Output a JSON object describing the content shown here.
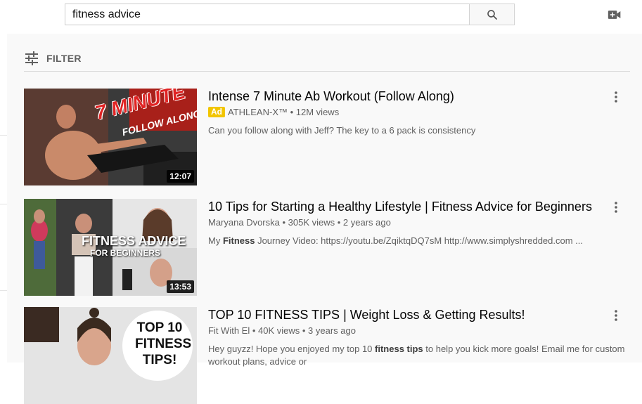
{
  "search": {
    "value": "fitness advice"
  },
  "icons": {
    "search": "search-icon",
    "create": "video-camera-add-icon",
    "filter": "filter-sliders-icon",
    "menu": "more-vert-icon"
  },
  "filter": {
    "label": "FILTER"
  },
  "results": [
    {
      "title": "Intense 7 Minute Ab Workout (Follow Along)",
      "ad_label": "Ad",
      "channel": "ATHLEAN-X™",
      "views": "12M views",
      "age": "",
      "desc_plain": "Can you follow along with Jeff? The key to a 6 pack is consistency",
      "duration": "12:07",
      "thumb_text_main": "7 MINUTE",
      "thumb_text_sub": "FOLLOW ALONG!"
    },
    {
      "title": "10 Tips for Starting a Healthy Lifestyle | Fitness Advice for Beginners",
      "channel": "Maryana Dvorska",
      "views": "305K views",
      "age": "2 years ago",
      "desc_pre": "My ",
      "desc_bold": "Fitness",
      "desc_post": " Journey Video: https://youtu.be/ZqiktqDQ7sM http://www.simplyshredded.com ...",
      "duration": "13:53",
      "thumb_text_main": "FITNESS ADVICE",
      "thumb_text_sub": "FOR BEGINNERS"
    },
    {
      "title": "TOP 10 FITNESS TIPS | Weight Loss & Getting Results!",
      "channel": "Fit With El",
      "views": "40K views",
      "age": "3 years ago",
      "desc_pre": "Hey guyzz! Hope you enjoyed my top 10 ",
      "desc_bold": "fitness tips",
      "desc_post": " to help you kick more goals! Email me for custom workout plans, advice or",
      "thumb_text_line1": "TOP 10",
      "thumb_text_line2": "FITNESS",
      "thumb_text_line3": "TIPS!"
    }
  ],
  "colors": {
    "ad_badge": "#f2c500",
    "background": "#f9f9f9",
    "meta_text": "#606060"
  }
}
